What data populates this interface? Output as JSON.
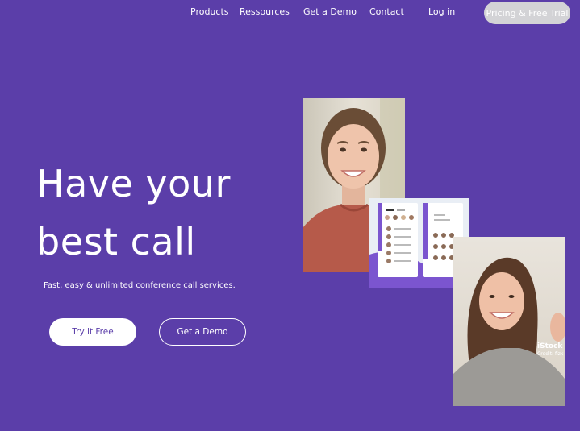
{
  "nav": {
    "items": [
      "Products",
      "Ressources",
      "Get a Demo",
      "Contact",
      "Log in"
    ],
    "cta": "Pricing & Free Trial"
  },
  "hero": {
    "title_line1": "Have your",
    "title_line2": "best call",
    "subtitle": "Fast, easy & unlimited conference call services.",
    "primary_button": "Try it Free",
    "secondary_button": "Get a Demo"
  },
  "mockup": {
    "left_tabs": [
      "Chat",
      "Group"
    ],
    "right_tabs": [
      "Chat",
      "Group"
    ],
    "right_heading_line1": "Create",
    "right_heading_line2": "New Group"
  },
  "watermark": {
    "brand": "iStock",
    "credit": "Credit: fizk"
  },
  "colors": {
    "background": "#5b3ea9",
    "accent": "#7b55cf",
    "cta_background": "#d3d3d6",
    "text": "#ffffff"
  }
}
